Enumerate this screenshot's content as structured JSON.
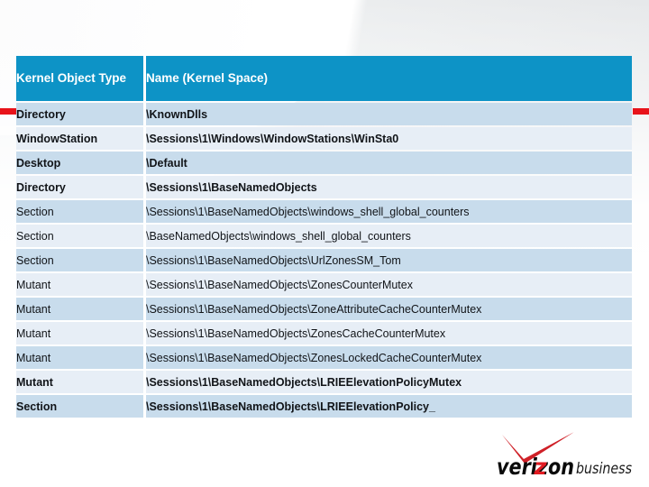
{
  "slide": {
    "accent_color": "#e8131a",
    "header_fill": "#0d93c6",
    "band_a": "#c8dcec",
    "band_b": "#e7eef6"
  },
  "table": {
    "columns": [
      {
        "key": "type",
        "header": "Kernel Object Type"
      },
      {
        "key": "name",
        "header": "Name (Kernel Space)"
      }
    ],
    "rows": [
      {
        "type": "Directory",
        "name": "\\KnownDlls"
      },
      {
        "type": "WindowStation",
        "name": "\\Sessions\\1\\Windows\\WindowStations\\WinSta0"
      },
      {
        "type": "Desktop",
        "name": "\\Default"
      },
      {
        "type": "Directory",
        "name": "\\Sessions\\1\\BaseNamedObjects"
      },
      {
        "type": "Section",
        "name": "\\Sessions\\1\\BaseNamedObjects\\windows_shell_global_counters"
      },
      {
        "type": "Section",
        "name": "\\BaseNamedObjects\\windows_shell_global_counters"
      },
      {
        "type": "Section",
        "name": "\\Sessions\\1\\BaseNamedObjects\\UrlZonesSM_Tom"
      },
      {
        "type": "Mutant",
        "name": "\\Sessions\\1\\BaseNamedObjects\\ZonesCounterMutex"
      },
      {
        "type": "Mutant",
        "name": "\\Sessions\\1\\BaseNamedObjects\\ZoneAttributeCacheCounterMutex"
      },
      {
        "type": "Mutant",
        "name": "\\Sessions\\1\\BaseNamedObjects\\ZonesCacheCounterMutex"
      },
      {
        "type": "Mutant",
        "name": "\\Sessions\\1\\BaseNamedObjects\\ZonesLockedCacheCounterMutex"
      },
      {
        "type": "Mutant",
        "name": "\\Sessions\\1\\BaseNamedObjects\\LRIEElevationPolicyMutex"
      },
      {
        "type": "Section",
        "name": "\\Sessions\\1\\BaseNamedObjects\\LRIEElevationPolicy_"
      }
    ]
  },
  "logo": {
    "brand": "verizon",
    "suffix": "business",
    "check_color": "#cf2027",
    "z_color": "#e11b22",
    "word_color": "#0a0a0a",
    "suffix_color": "#1a1a1a"
  }
}
